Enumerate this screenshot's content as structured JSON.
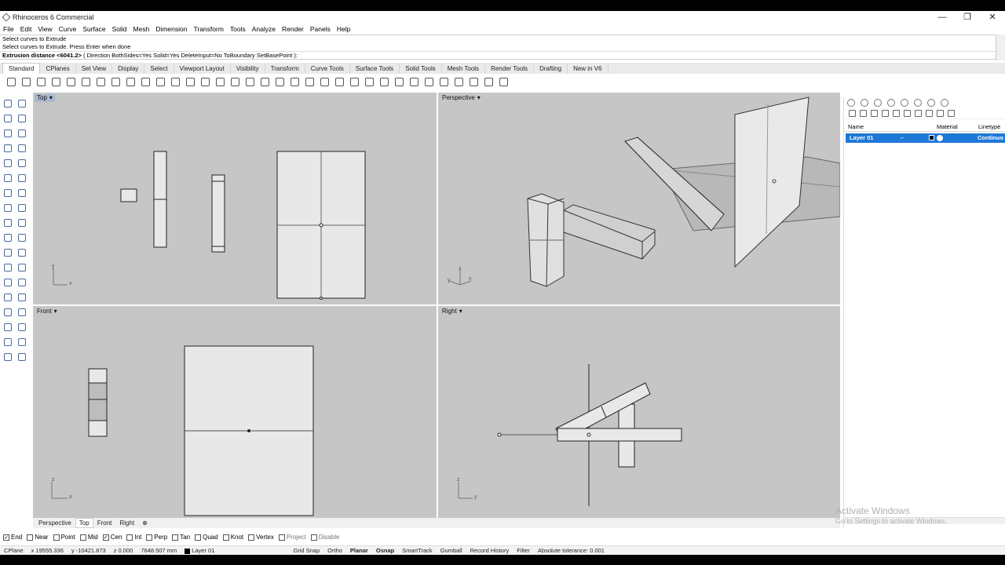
{
  "window": {
    "title": "Rhinoceros 6 Commercial",
    "controls": [
      "—",
      "❐",
      "✕"
    ]
  },
  "menu": [
    "File",
    "Edit",
    "View",
    "Curve",
    "Surface",
    "Solid",
    "Mesh",
    "Dimension",
    "Transform",
    "Tools",
    "Analyze",
    "Render",
    "Panels",
    "Help"
  ],
  "command": {
    "history": [
      "Select curves to Extrude",
      "Select curves to Extrude. Press Enter when done"
    ],
    "prompt": "Extrusion distance <6041.2>",
    "options": "( Direction  BothSides=Yes  Solid=Yes  DeleteInput=No  ToBoundary  SetBasePoint ):"
  },
  "toolbar_tabs": [
    "Standard",
    "CPlanes",
    "Set View",
    "Display",
    "Select",
    "Viewport Layout",
    "Visibility",
    "Transform",
    "Curve Tools",
    "Surface Tools",
    "Solid Tools",
    "Mesh Tools",
    "Render Tools",
    "Drafting",
    "New in V6"
  ],
  "viewports": {
    "top": {
      "label": "Top"
    },
    "perspective": {
      "label": "Perspective"
    },
    "front": {
      "label": "Front"
    },
    "right": {
      "label": "Right"
    },
    "axes": {
      "x": "x",
      "y": "y",
      "z": "z"
    }
  },
  "viewport_tabs": [
    "Perspective",
    "Top",
    "Front",
    "Right"
  ],
  "viewport_tabs_add": "⊕",
  "layers_panel": {
    "columns": {
      "name": "Name",
      "material": "Material",
      "linetype": "Linetype"
    },
    "rows": [
      {
        "name": "Layer 01",
        "linetype": "Continuo"
      }
    ]
  },
  "osnaps": [
    {
      "label": "End",
      "checked": true
    },
    {
      "label": "Near",
      "checked": false
    },
    {
      "label": "Point",
      "checked": false
    },
    {
      "label": "Mid",
      "checked": false
    },
    {
      "label": "Cen",
      "checked": true
    },
    {
      "label": "Int",
      "checked": false
    },
    {
      "label": "Perp",
      "checked": false
    },
    {
      "label": "Tan",
      "checked": false
    },
    {
      "label": "Quad",
      "checked": false
    },
    {
      "label": "Knot",
      "checked": false
    },
    {
      "label": "Vertex",
      "checked": false
    },
    {
      "label": "Project",
      "checked": false
    },
    {
      "label": "Disable",
      "checked": false
    }
  ],
  "status": {
    "cplane": "CPlane",
    "x": "x 19555.336",
    "y": "y -10421.873",
    "z": "z 0.000",
    "distance": "7648.507 mm",
    "layer": "Layer 01",
    "grid_snap": "Grid Snap",
    "ortho": "Ortho",
    "planar": "Planar",
    "osnap": "Osnap",
    "smarttrack": "SmartTrack",
    "gumball": "Gumball",
    "record_history": "Record History",
    "filter": "Filter",
    "tolerance": "Absolute tolerance: 0.001"
  },
  "watermark": {
    "title": "Activate Windows",
    "subtitle": "Go to Settings to activate Windows."
  },
  "colors": {
    "viewport_bg": "#c6c6c6",
    "active_label": "#a9b8cc",
    "layer_selected": "#1e78d7"
  }
}
